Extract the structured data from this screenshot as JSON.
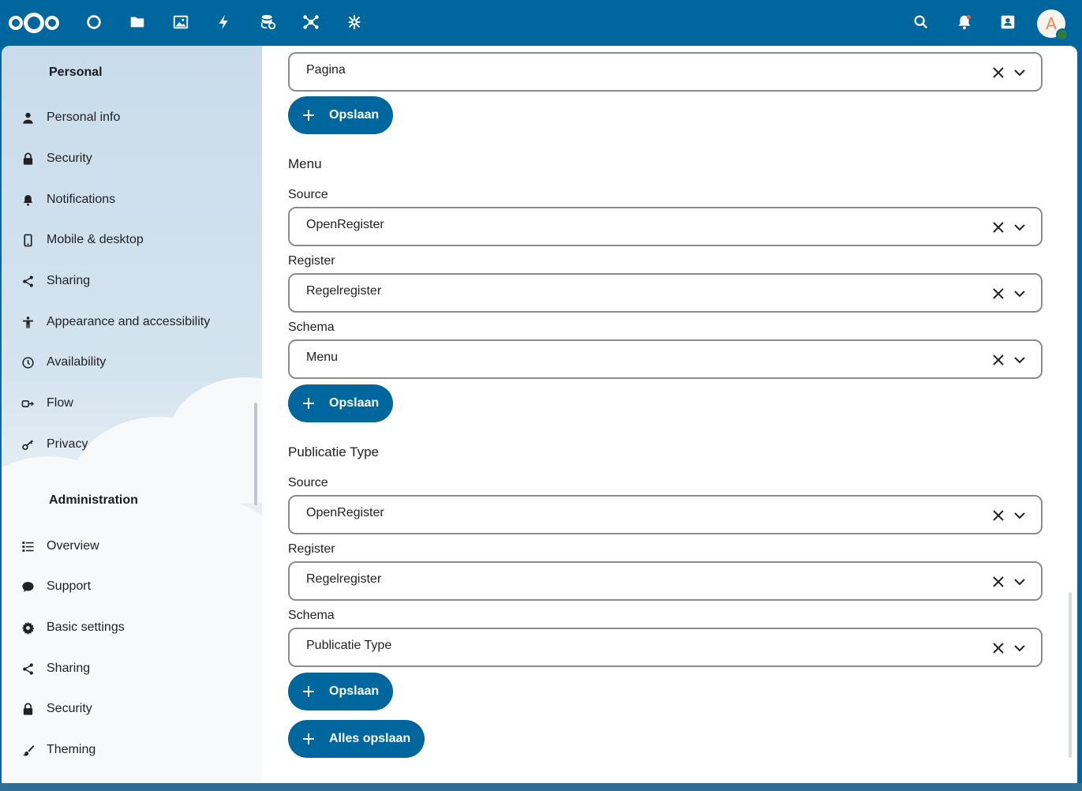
{
  "header": {
    "apps": [
      {
        "name": "Dashboard",
        "icon": "dashboard-circle-icon"
      },
      {
        "name": "Files",
        "icon": "folder-icon"
      },
      {
        "name": "Photos",
        "icon": "image-icon"
      },
      {
        "name": "Activity",
        "icon": "lightning-icon"
      },
      {
        "name": "Data",
        "icon": "database-sync-icon"
      },
      {
        "name": "Connections",
        "icon": "hub-icon"
      },
      {
        "name": "App",
        "icon": "custom-app-icon"
      }
    ],
    "avatar_initial": "A",
    "icons": [
      "search-icon",
      "bell-icon",
      "contacts-icon"
    ],
    "accent_color": "#00679e",
    "status_color": "#2d7b41"
  },
  "sidebar": {
    "personal_heading": "Personal",
    "personal_items": [
      {
        "label": "Personal info",
        "icon": "person-icon"
      },
      {
        "label": "Security",
        "icon": "lock-icon"
      },
      {
        "label": "Notifications",
        "icon": "bell-icon"
      },
      {
        "label": "Mobile & desktop",
        "icon": "phone-icon"
      },
      {
        "label": "Sharing",
        "icon": "share-icon"
      },
      {
        "label": "Appearance and accessibility",
        "icon": "accessibility-icon"
      },
      {
        "label": "Availability",
        "icon": "clock-icon"
      },
      {
        "label": "Flow",
        "icon": "flow-icon"
      },
      {
        "label": "Privacy",
        "icon": "key-icon"
      }
    ],
    "admin_heading": "Administration",
    "admin_items": [
      {
        "label": "Overview",
        "icon": "list-icon"
      },
      {
        "label": "Support",
        "icon": "chat-icon"
      },
      {
        "label": "Basic settings",
        "icon": "gear-icon"
      },
      {
        "label": "Sharing",
        "icon": "share-icon"
      },
      {
        "label": "Security",
        "icon": "lock-icon"
      },
      {
        "label": "Theming",
        "icon": "brush-icon"
      }
    ]
  },
  "main": {
    "top_select_value": "Pagina",
    "save_label": "Opslaan",
    "menu_section": {
      "title": "Menu",
      "source_label": "Source",
      "source_value": "OpenRegister",
      "register_label": "Register",
      "register_value": "Regelregister",
      "schema_label": "Schema",
      "schema_value": "Menu"
    },
    "publicatie_section": {
      "title": "Publicatie Type",
      "source_label": "Source",
      "source_value": "OpenRegister",
      "register_label": "Register",
      "register_value": "Regelregister",
      "schema_label": "Schema",
      "schema_value": "Publicatie Type"
    },
    "save_all_label": "Alles opslaan"
  }
}
